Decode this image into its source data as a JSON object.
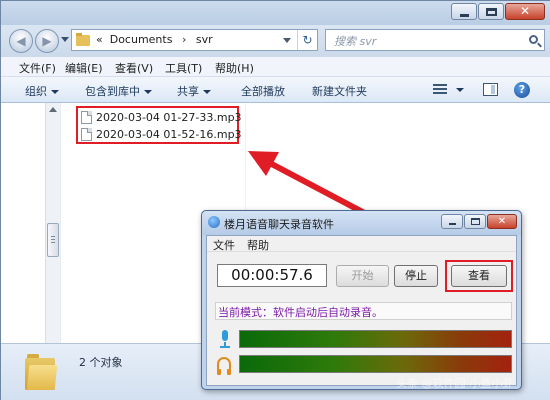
{
  "explorer": {
    "address": {
      "prefix": "«",
      "crumbs": [
        "Documents",
        "svr"
      ],
      "separator": "›"
    },
    "search": {
      "placeholder": "搜索 svr"
    },
    "menu": [
      "文件(F)",
      "编辑(E)",
      "查看(V)",
      "工具(T)",
      "帮助(H)"
    ],
    "toolbar": {
      "organize": "组织",
      "include_library": "包含到库中",
      "share": "共享",
      "play_all": "全部播放",
      "new_folder": "新建文件夹"
    },
    "files": [
      {
        "name": "2020-03-04 01-27-33.mp3"
      },
      {
        "name": "2020-03-04 01-52-16.mp3"
      }
    ],
    "status": {
      "count": "2 个对象"
    }
  },
  "recorder": {
    "title": "楼月语音聊天录音软件",
    "menu": [
      "文件",
      "帮助"
    ],
    "timer": "00:00:57.6",
    "buttons": {
      "start": "开始",
      "stop": "停止",
      "view": "查看"
    },
    "mode": "当前模式：软件启动后自动录音。",
    "meters": {
      "mic_level": 1.0,
      "speaker_level": 1.0
    }
  },
  "watermark": "头条 @软件园-小鱼小虾",
  "colors": {
    "highlight": "#e01c24",
    "arrow": "#e01c24",
    "mode_text": "#7d1aa8",
    "mic_icon": "#2f9bd8",
    "headphone_icon": "#e28a1d"
  },
  "icons": {
    "back": "back-arrow-icon",
    "forward": "forward-arrow-icon",
    "refresh": "refresh-icon",
    "search": "search-icon",
    "help": "help-icon",
    "file": "file-icon",
    "folder": "folder-icon",
    "mic": "microphone-icon",
    "headphone": "headphone-icon"
  }
}
